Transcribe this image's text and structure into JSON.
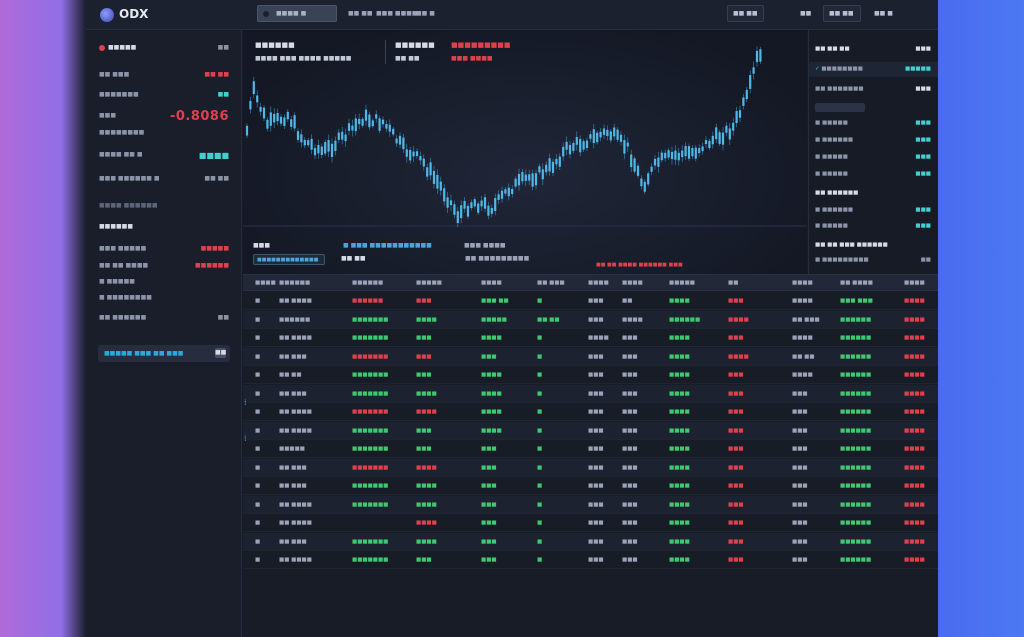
{
  "app": {
    "logo": "ODX"
  },
  "topbar": {
    "search_placeholder": "■■■■ ■",
    "nav": [
      "■■ ■■",
      "■■■ ■■■■",
      "■■ ■"
    ],
    "btn1": "■■ ■■",
    "btn2": "■■",
    "btn3": "■■ ■■",
    "btn4": "■■ ■"
  },
  "left": {
    "header_label": "■■■■■",
    "header_value": "■■",
    "rows": [
      {
        "k": "■■ ■■■",
        "v": "■■ ■■"
      },
      {
        "k": "■■■■■■■",
        "v": "■■"
      },
      {
        "k": "■■■",
        "v": "-0.8086"
      },
      {
        "k": "■■■■■■■■",
        "v": ""
      },
      {
        "k": "■■■■ ■■ ■",
        "v": "■■■■"
      },
      {
        "k": "■■■ ■■■■■■ ■",
        "v": "■■ ■■"
      },
      {
        "k": "■■■■ ■■■■■■",
        "v": ""
      },
      {
        "k": "■■■■■■",
        "v": ""
      },
      {
        "k": "■■■ ■■■■■",
        "v": "■■■■■"
      },
      {
        "k": "■■ ■■ ■■■■",
        "v": "■■■■■■"
      },
      {
        "k": "■ ■■■■■",
        "v": ""
      },
      {
        "k": "■ ■■■■■■■■",
        "v": ""
      },
      {
        "k": "■■ ■■■■■■",
        "v": "■■"
      }
    ],
    "button_label": "■■■■■ ■■■ ■■ ■■■",
    "button_icon": "■■"
  },
  "chart": {
    "head_left": "■■■■■■",
    "head_left_sub": "■■■■ ■■■ ■■■■ ■■■■■",
    "head_mid": "■■■■■■",
    "head_mid_sub": "■■ ■■",
    "head_red": "■■■■■■■■■",
    "head_red_sub": "■■■ ■■■■",
    "foot_left": "■■■",
    "foot_mid": "■ ■■■ ■■■■■■■■■■■",
    "foot_right": "■■■ ■■■■",
    "foot_chip": "■■■■■■■■■■■■■",
    "foot_a": "■■ ■■",
    "foot_b": "■■ ■■■■■■■■■",
    "foot_c": "■■ ■■ ■■■■ ■■■■■■ ■■■"
  },
  "book": {
    "title": "■■ ■■ ■■",
    "title_right": "■■■",
    "hl_label": "■■■■■■■■",
    "hl_value": "■■■■■",
    "rows": [
      {
        "k": "■■ ■■■■■■■",
        "v": "■■■"
      },
      {
        "k": "■ ■■■■■",
        "v": "■■■"
      },
      {
        "k": "■ ■■■■■■",
        "v": "■■■"
      },
      {
        "k": "■ ■■■■■",
        "v": "■■■"
      },
      {
        "k": "■ ■■■■■",
        "v": "■■■"
      }
    ],
    "mid_title": "■■ ■■■■■■",
    "rows2": [
      {
        "k": "■ ■■■■■■",
        "v": "■■■"
      },
      {
        "k": "■ ■■■■■",
        "v": "■■■"
      }
    ],
    "title2": "■■ ■■ ■■■ ■■■■■■",
    "last": {
      "k": "■ ■■■■■■■■■",
      "v": "■■"
    }
  },
  "table": {
    "headers": [
      "■■■■",
      "■■■■■■",
      "■■■■■■",
      "■■■■■",
      "■■■■",
      "■■ ■■■",
      "■■■■",
      "■■■■",
      "■■■■■",
      "■■",
      "■■■■",
      "■■ ■■■■",
      "■■■■"
    ],
    "rows": [
      [
        "■",
        "■■ ■■■■",
        "■■■■■■",
        "■■■",
        "■■■ ■■",
        "■",
        "■■■",
        "■■",
        "■■■■",
        "■■■",
        "■■■■",
        "■■■ ■■■",
        "■■■■"
      ],
      [
        "■",
        "■■■■■■",
        "■■■■■■■",
        "■■■■",
        "■■■■■",
        "■■ ■■",
        "■■■",
        "■■■■",
        "■■■■■■",
        "■■■■",
        "■■ ■■■",
        "■■■■■■",
        "■■■■"
      ],
      [
        "■",
        "■■ ■■■■",
        "■■■■■■■",
        "■■■",
        "■■■■",
        "■",
        "■■■■",
        "■■■",
        "■■■■",
        "■■■",
        "■■■■",
        "■■■■■■",
        "■■■■"
      ],
      [
        "■",
        "■■ ■■■",
        "■■■■■■■",
        "■■■",
        "■■■",
        "■",
        "■■■",
        "■■■",
        "■■■■",
        "■■■■",
        "■■ ■■",
        "■■■■■■",
        "■■■■"
      ],
      [
        "■",
        "■■ ■■",
        "■■■■■■■",
        "■■■",
        "■■■■",
        "■",
        "■■■",
        "■■■",
        "■■■■",
        "■■■",
        "■■■■",
        "■■■■■■",
        "■■■■"
      ],
      [
        "■",
        "■■ ■■■",
        "■■■■■■■",
        "■■■■",
        "■■■■",
        "■",
        "■■■",
        "■■■",
        "■■■■",
        "■■■",
        "■■■",
        "■■■■■■",
        "■■■■"
      ],
      [
        "■",
        "■■ ■■■■",
        "■■■■■■■",
        "■■■■",
        "■■■■",
        "■",
        "■■■",
        "■■■",
        "■■■■",
        "■■■",
        "■■■",
        "■■■■■■",
        "■■■■"
      ],
      [
        "■",
        "■■ ■■■■",
        "■■■■■■■",
        "■■■",
        "■■■■",
        "■",
        "■■■",
        "■■■",
        "■■■■",
        "■■■",
        "■■■",
        "■■■■■■",
        "■■■■"
      ],
      [
        "■",
        "■■■■■",
        "■■■■■■■",
        "■■■",
        "■■■",
        "■",
        "■■■",
        "■■■",
        "■■■■",
        "■■■",
        "■■■",
        "■■■■■■",
        "■■■■"
      ],
      [
        "■",
        "■■ ■■■",
        "■■■■■■■",
        "■■■■",
        "■■■",
        "■",
        "■■■",
        "■■■",
        "■■■■",
        "■■■",
        "■■■",
        "■■■■■■",
        "■■■■"
      ],
      [
        "■",
        "■■ ■■■",
        "■■■■■■■",
        "■■■■",
        "■■■",
        "■",
        "■■■",
        "■■■",
        "■■■■",
        "■■■",
        "■■■",
        "■■■■■■",
        "■■■■"
      ],
      [
        "■",
        "■■ ■■■■",
        "■■■■■■■",
        "■■■■",
        "■■■",
        "■",
        "■■■",
        "■■■",
        "■■■■",
        "■■■",
        "■■■",
        "■■■■■■",
        "■■■■"
      ],
      [
        "■",
        "■■ ■■■■",
        "",
        "■■■■",
        "■■■",
        "■",
        "■■■",
        "■■■",
        "■■■■",
        "■■■",
        "■■■",
        "■■■■■■",
        "■■■■"
      ],
      [
        "■",
        "■■ ■■■",
        "■■■■■■■",
        "■■■■",
        "■■■",
        "■",
        "■■■",
        "■■■",
        "■■■■",
        "■■■",
        "■■■",
        "■■■■■■",
        "■■■■"
      ],
      [
        "■",
        "■■ ■■■■",
        "■■■■■■■",
        "■■■",
        "■■■",
        "■",
        "■■■",
        "■■■",
        "■■■■",
        "■■■",
        "■■■",
        "■■■■■■",
        "■■■■"
      ]
    ]
  },
  "colors": {
    "red": "#e0404c",
    "green": "#3fc870",
    "cyan": "#3fd0d0",
    "candle": "#4fb8e8"
  }
}
